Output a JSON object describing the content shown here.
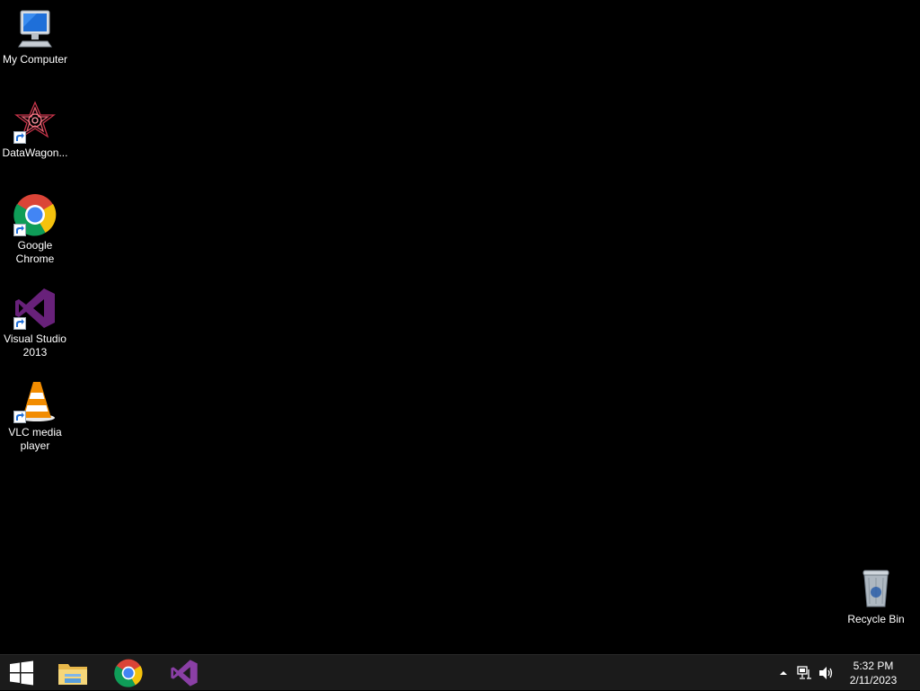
{
  "desktop": {
    "icons": [
      {
        "label": "My Computer",
        "icon": "my-computer-icon"
      },
      {
        "label": "DataWagon...",
        "icon": "datawagon-icon"
      },
      {
        "label": "Google Chrome",
        "icon": "chrome-icon"
      },
      {
        "label": "Visual Studio 2013",
        "icon": "visual-studio-icon"
      },
      {
        "label": "VLC media player",
        "icon": "vlc-icon"
      },
      {
        "label": "Recycle Bin",
        "icon": "recycle-bin-icon"
      }
    ]
  },
  "taskbar": {
    "pinned": [
      {
        "icon": "windows-start-icon"
      },
      {
        "icon": "file-explorer-icon"
      },
      {
        "icon": "chrome-icon"
      },
      {
        "icon": "visual-studio-icon"
      }
    ],
    "tray": {
      "icons": [
        "show-hidden-icons-arrow",
        "network-icon",
        "volume-icon"
      ],
      "time": "5:32 PM",
      "date": "2/11/2023"
    }
  },
  "colors": {
    "desktop_background": "#000000",
    "taskbar_background": "#1b1b1b",
    "visual_studio_purple": "#68217a"
  }
}
